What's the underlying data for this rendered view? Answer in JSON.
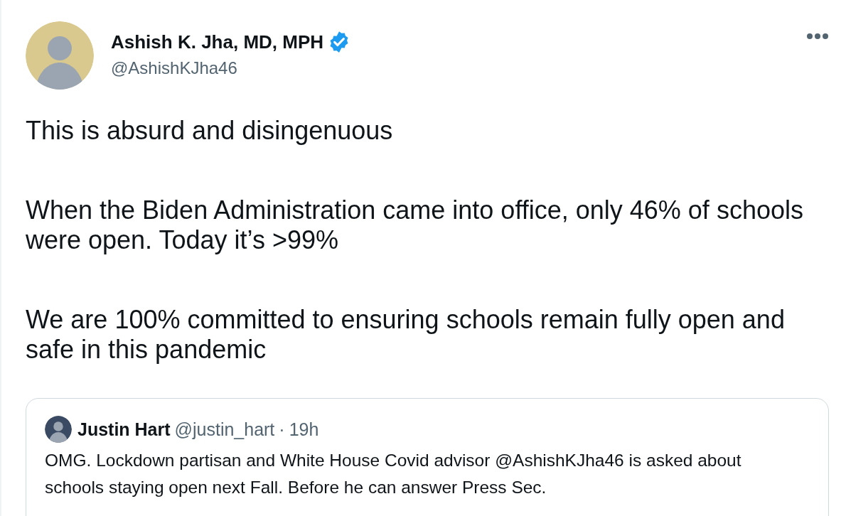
{
  "author": {
    "name": "Ashish K. Jha, MD, MPH",
    "verified": true,
    "handle": "@AshishKJha46"
  },
  "paragraphs": [
    "This is absurd and disingenuous",
    "When the Biden Administration came into office, only 46% of schools were open. Today it’s >99%",
    "We are 100% committed to ensuring schools remain fully open and safe in this pandemic"
  ],
  "quoted_tweet": {
    "name": "Justin Hart",
    "handle": "@justin_hart",
    "separator": "·",
    "time": "19h",
    "text": "OMG. Lockdown partisan and White House Covid advisor @AshishKJha46 is asked about schools staying open next Fall. Before he can answer Press Sec."
  }
}
